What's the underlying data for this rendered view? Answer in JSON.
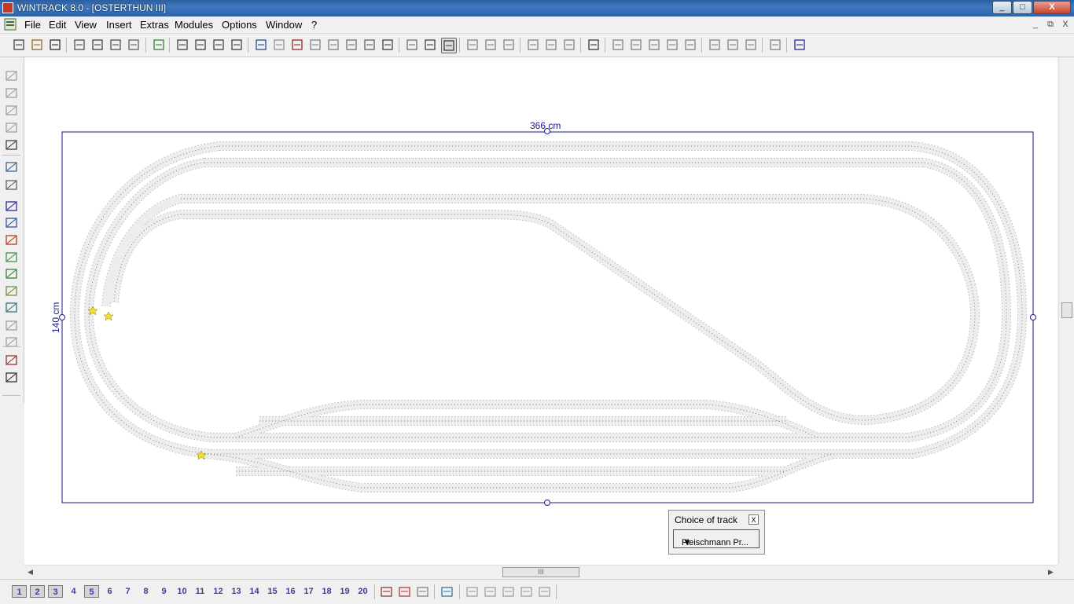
{
  "window": {
    "title": "WINTRACK 8.0 - [OSTERTHUN III]",
    "min": "_",
    "max": "□",
    "close": "X"
  },
  "menu": [
    "File",
    "Edit",
    "View",
    "Insert",
    "Extras",
    "Modules",
    "Options",
    "Window",
    "?"
  ],
  "mdi_buttons": [
    "_",
    "⧉",
    "X"
  ],
  "toolbar_icons": [
    "new-icon",
    "open-icon",
    "save-icon",
    "print-preview-icon",
    "print-icon",
    "print-setup-icon",
    "layout-icon",
    "image-icon",
    "zoom-out-icon",
    "zoom-in-icon",
    "zoom-window-icon",
    "zoom-fit-icon",
    "undo-icon",
    "redo-icon",
    "parts-list-icon",
    "copy-format-icon",
    "paste-format-icon",
    "cut-icon",
    "copy-icon",
    "paste-icon",
    "turnout-icon",
    "curve-icon",
    "flex-track-icon",
    "align-icon",
    "group-icon",
    "ungroup-icon",
    "connect-icon",
    "rotate-icon",
    "rotate-180-icon",
    "insert-point-icon",
    "split-icon",
    "mirror-icon",
    "straighten-icon",
    "join-icon",
    "extend-icon",
    "measure-icon",
    "angle-icon",
    "radius-icon",
    "gauge-icon",
    "help-cursor-icon"
  ],
  "drawing": {
    "width_label": "366 cm",
    "height_label": "140 cm",
    "track_color": "#ebebeb",
    "border_color": "#1a1a8a"
  },
  "choice_of_track": {
    "title": "Choice of track",
    "close": "X",
    "selected": "Fleischmann Pr..."
  },
  "layers": [
    "1",
    "2",
    "3",
    "4",
    "5",
    "6",
    "7",
    "8",
    "9",
    "10",
    "11",
    "12",
    "13",
    "14",
    "15",
    "16",
    "17",
    "18",
    "19",
    "20"
  ],
  "status_icons": [
    "layers-icon",
    "layer-edit-icon",
    "layer-hide-icon",
    "layer-stack-icon",
    "view-1-icon",
    "view-2-icon",
    "view-3-icon",
    "view-4-icon",
    "view-5-icon"
  ],
  "hscroll_thumb": "III"
}
